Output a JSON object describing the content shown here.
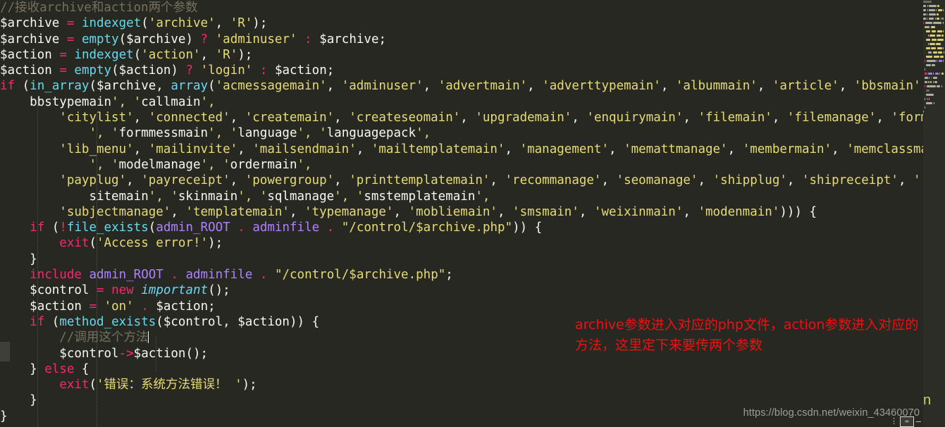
{
  "app": {
    "kind": "code-editor",
    "language": "php",
    "theme": "monokai",
    "background": "#272822"
  },
  "code": {
    "lines": [
      "//接收archive和action两个参数",
      "$archive = indexget('archive', 'R');",
      "$archive = empty($archive) ? 'adminuser' : $archive;",
      "$action = indexget('action', 'R');",
      "$action = empty($action) ? 'login' : $action;",
      "if (in_array($archive, array('acmessagemain', 'adminuser', 'advertmain', 'adverttypemain', 'albummain', 'article', 'bbsmain', '",
      "    bbstypemain', 'callmain',",
      "        'citylist', 'connected', 'createmain', 'createseomain', 'upgrademain', 'enquirymain', 'filemain', 'filemanage', 'formmain",
      "            ', 'formmessmain', 'language', 'languagepack',",
      "        'lib_menu', 'mailinvite', 'mailsendmain', 'mailtemplatemain', 'management', 'memattmanage', 'membermain', 'memclassmanage",
      "            ', 'modelmanage', 'ordermain',",
      "        'payplug', 'payreceipt', 'powergroup', 'printtemplatemain', 'recommanage', 'seomanage', 'shipplug', 'shipreceipt', '",
      "            sitemain', 'skinmain', 'sqlmanage', 'smstemplatemain',",
      "        'subjectmanage', 'templatemain', 'typemanage', 'mobliemain', 'smsmain', 'weixinmain', 'modenmain'))) {",
      "    if (!file_exists(admin_ROOT . adminfile . \"/control/$archive.php\")) {",
      "        exit('Access error!');",
      "    }",
      "    include admin_ROOT . adminfile . \"/control/$archive.php\";",
      "    $control = new important();",
      "    $action = 'on' . $action;",
      "    if (method_exists($control, $action)) {",
      "        //调用这个方法",
      "        $control->$action();",
      "    } else {",
      "        exit('错误：系统方法错误！ ');",
      "    }",
      "}"
    ]
  },
  "annotation": {
    "text": "archive参数进入对应的php文件，action参数进入对应的\n方法，这里定下来要传两个参数",
    "color": "#ee1111"
  },
  "watermark": {
    "text": "https://blog.csdn.net/weixin_43460070",
    "color": "#a9a9a4"
  },
  "minimap": {
    "label": "n",
    "background": "#2c2d27"
  },
  "corner_widget": {
    "dots": "⋮",
    "key_label": "⌨",
    "dash": "—"
  },
  "palette": {
    "comment": "#75715e",
    "keyword": "#f92672",
    "function": "#66d9ef",
    "string": "#e6db74",
    "constant": "#ae81ff",
    "text": "#f8f8f2",
    "annotation": "#ee1111"
  }
}
